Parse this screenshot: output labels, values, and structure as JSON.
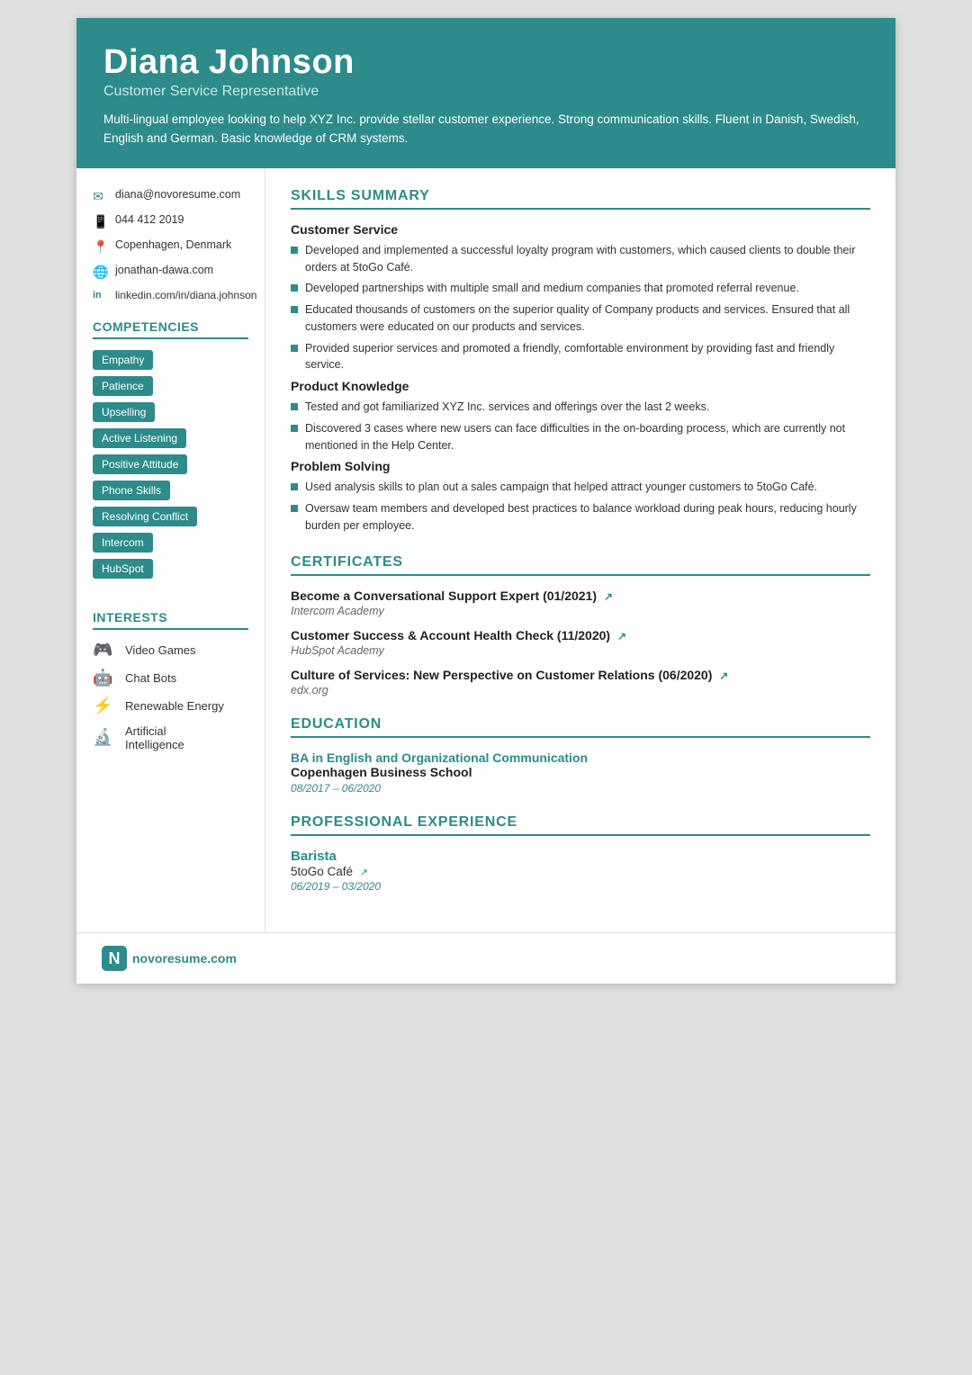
{
  "header": {
    "name": "Diana Johnson",
    "title": "Customer Service Representative",
    "summary": "Multi-lingual employee looking to help XYZ Inc. provide stellar customer experience. Strong communication skills. Fluent in Danish, Swedish, English and German. Basic knowledge of CRM systems."
  },
  "contact": {
    "email": "diana@novoresume.com",
    "phone": "044 412 2019",
    "location": "Copenhagen, Denmark",
    "website": "jonathan-dawa.com",
    "linkedin": "linkedin.com/in/diana.johnson"
  },
  "competencies": {
    "section_title": "COMPETENCIES",
    "items": [
      "Empathy",
      "Patience",
      "Upselling",
      "Active Listening",
      "Positive Attitude",
      "Phone Skills",
      "Resolving Conflict",
      "Intercom",
      "HubSpot"
    ]
  },
  "interests": {
    "section_title": "INTERESTS",
    "items": [
      {
        "label": "Video Games",
        "icon": "🎮"
      },
      {
        "label": "Chat Bots",
        "icon": "🤖"
      },
      {
        "label": "Renewable Energy",
        "icon": "⚡"
      },
      {
        "label": "Artificial Intelligence",
        "icon": "🔬"
      }
    ]
  },
  "skills_summary": {
    "section_title": "SKILLS SUMMARY",
    "categories": [
      {
        "name": "Customer Service",
        "bullets": [
          "Developed and implemented a successful loyalty program with customers, which caused clients to double their orders at 5toGo Café.",
          "Developed partnerships with multiple small and medium companies that promoted referral revenue.",
          "Educated thousands of customers on the superior quality of Company products and services. Ensured that all customers were educated on our products and services.",
          "Provided superior services and promoted a friendly, comfortable environment by providing fast and friendly service."
        ]
      },
      {
        "name": "Product Knowledge",
        "bullets": [
          "Tested and got familiarized XYZ Inc. services and offerings over the last 2 weeks.",
          "Discovered 3 cases where new users can face difficulties in the on-boarding process, which are currently not mentioned in the Help Center."
        ]
      },
      {
        "name": "Problem Solving",
        "bullets": [
          "Used analysis skills to plan out a sales campaign that helped attract younger customers to 5toGo Café.",
          "Oversaw team members and developed best practices to balance workload during peak hours, reducing hourly burden per employee."
        ]
      }
    ]
  },
  "certificates": {
    "section_title": "CERTIFICATES",
    "items": [
      {
        "title": "Become a Conversational Support Expert (01/2021)",
        "org": "Intercom Academy"
      },
      {
        "title": "Customer Success & Account Health Check (11/2020)",
        "org": "HubSpot Academy"
      },
      {
        "title": "Culture of Services: New Perspective on Customer Relations (06/2020)",
        "org": "edx.org"
      }
    ]
  },
  "education": {
    "section_title": "EDUCATION",
    "degree": "BA in English and Organizational Communication",
    "school": "Copenhagen Business School",
    "dates": "08/2017 – 06/2020"
  },
  "experience": {
    "section_title": "PROFESSIONAL EXPERIENCE",
    "jobs": [
      {
        "title": "Barista",
        "company": "5toGo Café",
        "dates": "06/2019 – 03/2020"
      }
    ]
  },
  "footer": {
    "logo_text": "novoresume.com"
  }
}
